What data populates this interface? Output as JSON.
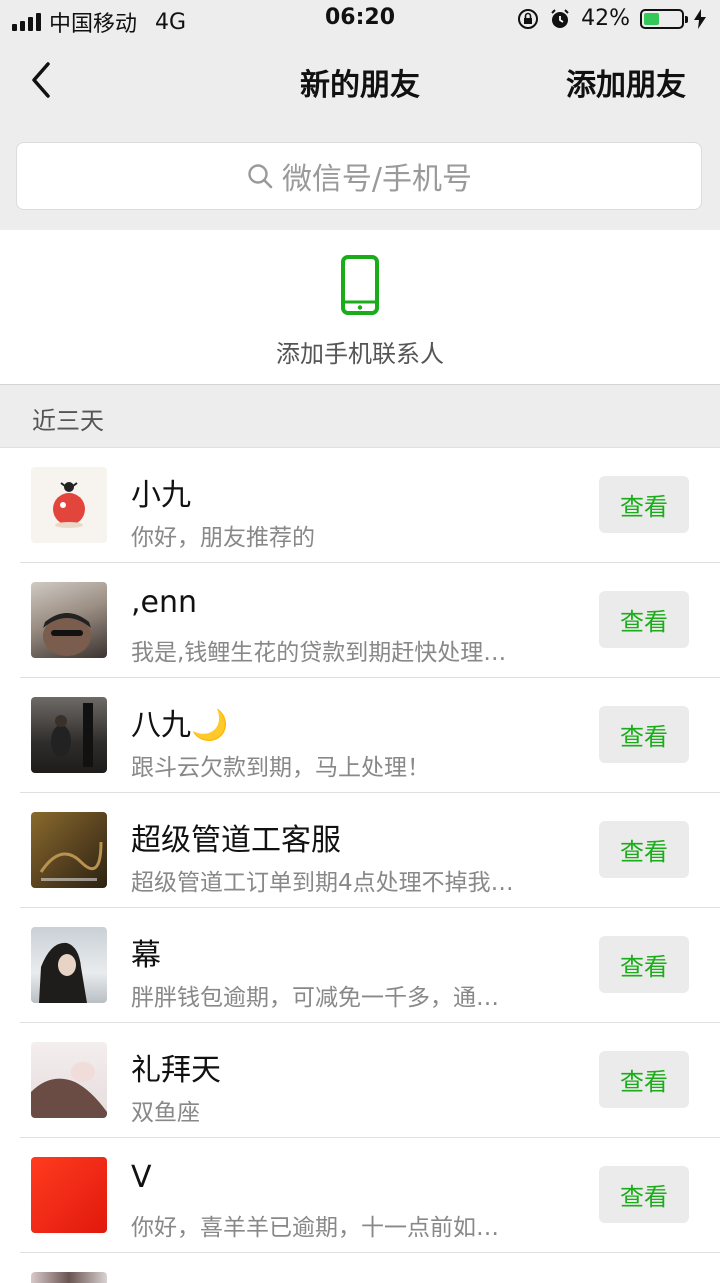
{
  "status_bar": {
    "carrier": "中国移动",
    "network": "4G",
    "time": "06:20",
    "battery": "42%",
    "battery_level": 0.42
  },
  "nav": {
    "title": "新的朋友",
    "right_action": "添加朋友"
  },
  "search": {
    "placeholder": "微信号/手机号"
  },
  "phone_contacts": {
    "label": "添加手机联系人"
  },
  "section": {
    "title": "近三天"
  },
  "requests": [
    {
      "name": "小九",
      "message": "你好，朋友推荐的",
      "action": "查看"
    },
    {
      "name": ",enn",
      "message": "我是,钱鲤生花的贷款到期赶快处理…",
      "action": "查看"
    },
    {
      "name": "八九🌙",
      "message": "跟斗云欠款到期，马上处理！",
      "action": "查看"
    },
    {
      "name": "超级管道工客服",
      "message": "超级管道工订单到期4点处理不掉我…",
      "action": "查看"
    },
    {
      "name": "幕",
      "message": "胖胖钱包逾期，可减免一千多，通…",
      "action": "查看"
    },
    {
      "name": "礼拜天",
      "message": "双鱼座",
      "action": "查看"
    },
    {
      "name": "V",
      "message": "你好，喜羊羊已逾期，十一点前如…",
      "action": "查看"
    }
  ],
  "colors": {
    "accent_green": "#1aad19",
    "battery_green": "#34c759",
    "background_gray": "#ededed"
  }
}
